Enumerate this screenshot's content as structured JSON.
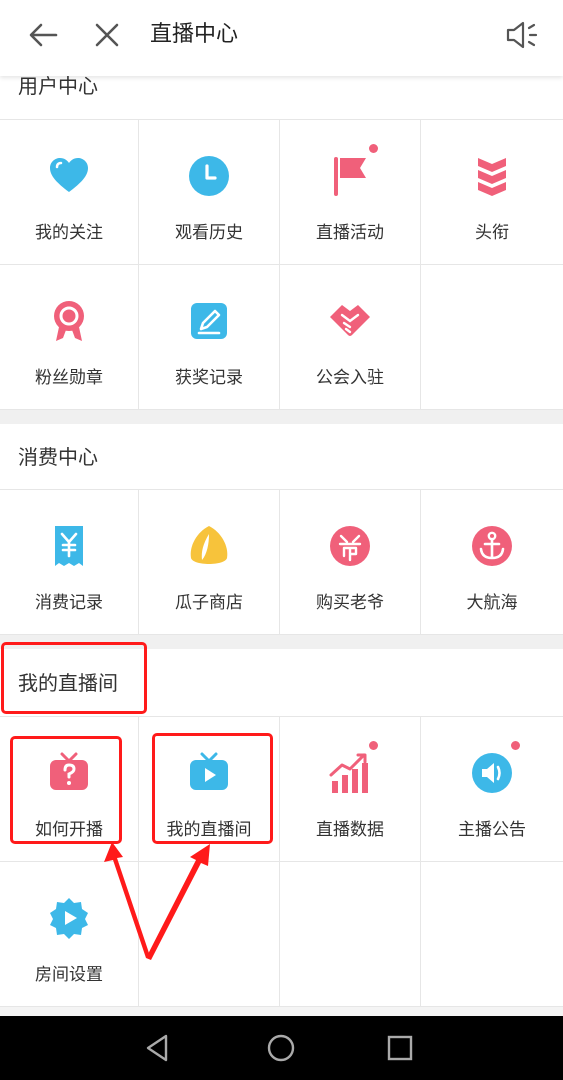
{
  "header": {
    "title": "直播中心"
  },
  "sections": {
    "user_center": {
      "title": "用户中心",
      "items": [
        {
          "label": "我的关注",
          "icon": "heart-icon"
        },
        {
          "label": "观看历史",
          "icon": "clock-icon"
        },
        {
          "label": "直播活动",
          "icon": "flag-icon"
        },
        {
          "label": "头衔",
          "icon": "rank-chevrons-icon"
        },
        {
          "label": "粉丝勋章",
          "icon": "medal-icon"
        },
        {
          "label": "获奖记录",
          "icon": "edit-note-icon"
        },
        {
          "label": "公会入驻",
          "icon": "handshake-icon"
        }
      ]
    },
    "consume_center": {
      "title": "消费中心",
      "items": [
        {
          "label": "消费记录",
          "icon": "yuan-receipt-icon"
        },
        {
          "label": "瓜子商店",
          "icon": "seed-icon"
        },
        {
          "label": "购买老爷",
          "icon": "ye-badge-icon"
        },
        {
          "label": "大航海",
          "icon": "anchor-icon"
        }
      ]
    },
    "my_live_room": {
      "title": "我的直播间",
      "items": [
        {
          "label": "如何开播",
          "icon": "tv-question-icon"
        },
        {
          "label": "我的直播间",
          "icon": "tv-play-icon"
        },
        {
          "label": "直播数据",
          "icon": "bar-trend-icon"
        },
        {
          "label": "主播公告",
          "icon": "megaphone-icon"
        },
        {
          "label": "房间设置",
          "icon": "gear-play-icon"
        }
      ]
    }
  },
  "colors": {
    "blue": "#3db8e8",
    "pink": "#f0607a",
    "yellow": "#f7c33b",
    "annotation": "#ff1a1a"
  }
}
